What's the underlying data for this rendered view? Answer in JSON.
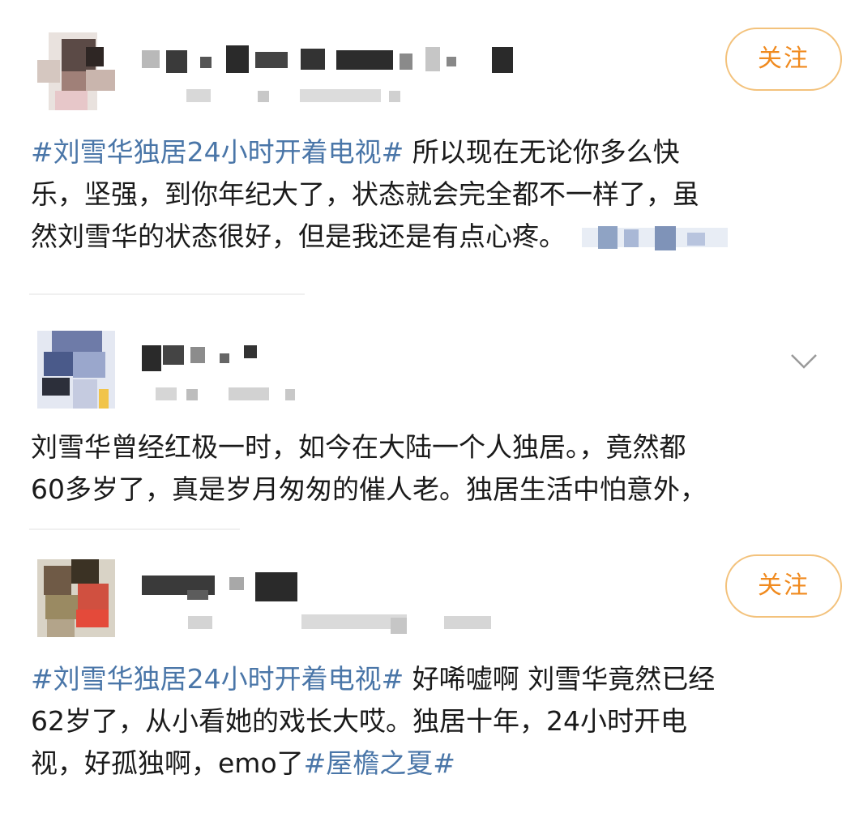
{
  "posts": [
    {
      "follow_label": "关注",
      "lines": [
        {
          "tag": "#刘雪华独居24小时开着电视#",
          "text": " 所以现在无论你多么快"
        },
        {
          "text": "乐，坚强，到你年纪大了，状态就会完全都不一样了，虽"
        },
        {
          "text": "然刘雪华的状态很好，但是我还是有点心疼。"
        }
      ]
    },
    {
      "lines": [
        {
          "text": "刘雪华曾经红极一时，如今在大陆一个人独居。，竟然都"
        },
        {
          "text": "60多岁了，真是岁月匆匆的催人老。独居生活中怕意外，"
        }
      ]
    },
    {
      "follow_label": "关注",
      "lines": [
        {
          "tag": "#刘雪华独居24小时开着电视#",
          "text": " 好唏嘘啊 刘雪华竟然已经"
        },
        {
          "text": "62岁了，从小看她的戏长大哎。独居十年，24小时开电"
        },
        {
          "text": "视，好孤独啊，emo了",
          "tag_after": "#屋檐之夏#"
        }
      ]
    }
  ],
  "icons": {
    "collapse": "chevron-down-icon"
  },
  "colors": {
    "topic_link": "#4a76a8",
    "follow_text": "#f08a1e",
    "follow_border": "#f3c27c"
  }
}
